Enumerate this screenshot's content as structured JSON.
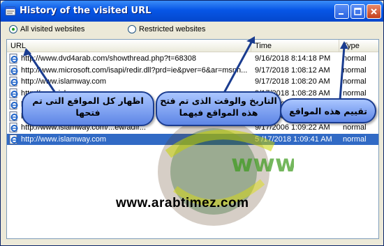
{
  "window": {
    "title": "History of the visited URL"
  },
  "filters": {
    "all_label": "All visited websites",
    "restricted_label": "Restricted websites",
    "selected": "all"
  },
  "columns": {
    "url": "URL",
    "time": "Time",
    "type": "Type"
  },
  "rows": [
    {
      "url": "http://www.dvd4arab.com/showthread.php?t=68308",
      "time": "9/16/2018 8:14:18 PM",
      "type": "normal"
    },
    {
      "url": "http://www.microsoft.com/isapi/redir.dll?prd=ie&pver=6&ar=msnh...",
      "time": "9/17/2018 1:08:12 AM",
      "type": "normal"
    },
    {
      "url": "http://www.islamway.com",
      "time": "9/17/2018 1:08:20 AM",
      "type": "normal"
    },
    {
      "url": "http://www.islamway.com",
      "time": "9/17/2018 1:08:28 AM",
      "type": "normal"
    },
    {
      "url": "http://www.islamway.com/...ew/adfr...",
      "time": "9/17/2006 1:08:38 AM",
      "type": "normal"
    },
    {
      "url": "http://www.islamway.com/...ew/adfr...",
      "time": "9/17/2006 1:09:00 AM",
      "type": "normal"
    },
    {
      "url": "http://www.islamway.com/...ew/adfr...",
      "time": "9/17/2006 1:09:22 AM",
      "type": "normal"
    },
    {
      "url": "http://www.islamway.com",
      "time": "5 /17/2018 1:09:41 AM",
      "type": "normal"
    }
  ],
  "selected_row": 7,
  "annotations": {
    "url_note": "اظهار كل المواقع التى تم فتحها",
    "time_note": "التاريخ والوقت الذى تم فتح هذه المواقع فيهما",
    "type_note": "تقييم هذه المواقع"
  },
  "watermark": {
    "text": "www.arabtimez.com",
    "logo_text": "www."
  }
}
